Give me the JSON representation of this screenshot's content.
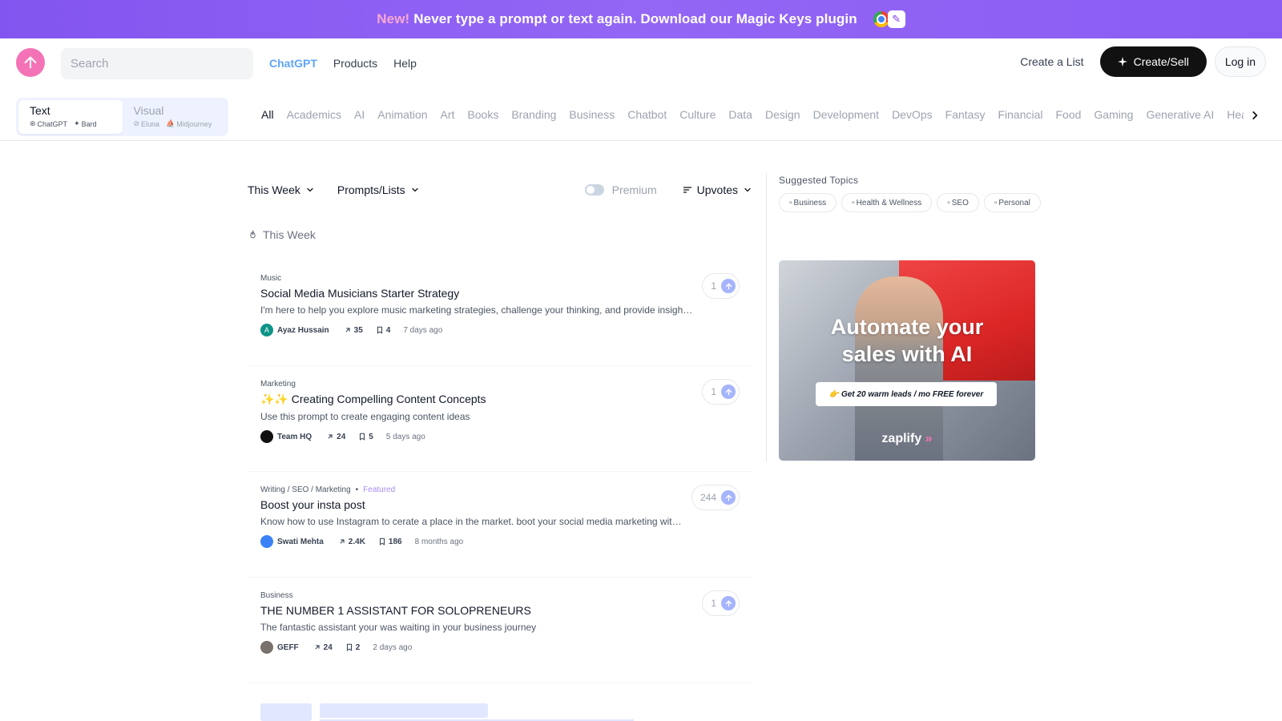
{
  "banner": {
    "new_label": "New!",
    "text": "Never type a prompt or text again. Download our Magic Keys plugin"
  },
  "header": {
    "search_placeholder": "Search",
    "nav": [
      {
        "label": "ChatGPT",
        "active": true
      },
      {
        "label": "Products",
        "active": false
      },
      {
        "label": "Help",
        "active": false
      }
    ],
    "create_list": "Create a List",
    "create_sell": "Create/Sell",
    "login": "Log in"
  },
  "modes": {
    "text": {
      "title": "Text",
      "sub": [
        "ChatGPT",
        "Bard"
      ]
    },
    "visual": {
      "title": "Visual",
      "sub": [
        "Eluna",
        "Midjourney"
      ]
    }
  },
  "categories": [
    "All",
    "Academics",
    "AI",
    "Animation",
    "Art",
    "Books",
    "Branding",
    "Business",
    "Chatbot",
    "Culture",
    "Data",
    "Design",
    "Development",
    "DevOps",
    "Fantasy",
    "Financial",
    "Food",
    "Gaming",
    "Generative AI",
    "Health"
  ],
  "filters": {
    "period": "This Week",
    "type": "Prompts/Lists",
    "premium": "Premium",
    "sort": "Upvotes"
  },
  "section_heading": "This Week",
  "prompts": [
    {
      "category": "Music",
      "featured": "",
      "title": "Social Media Musicians Starter Strategy",
      "description": "I'm here to help you explore music marketing strategies, challenge your thinking, and provide insights for your journey.",
      "author": "Ayaz Hussain",
      "avatar_letter": "A",
      "avatar_color": "#0d9488",
      "uses": "35",
      "saves": "4",
      "time": "7 days ago",
      "upvotes": "1"
    },
    {
      "category": "Marketing",
      "featured": "",
      "title": "✨✨ Creating Compelling Content Concepts",
      "description": "Use this prompt to create engaging content ideas",
      "author": "Team HQ",
      "avatar_letter": "",
      "avatar_color": "#111111",
      "uses": "24",
      "saves": "5",
      "time": "5 days ago",
      "upvotes": "1"
    },
    {
      "category": "Writing / SEO / Marketing",
      "featured": "Featured",
      "title": "Boost your insta post",
      "description": "Know how to use Instagram to cerate a place in the market. boot your social media marketing with these prompts",
      "author": "Swati Mehta",
      "avatar_letter": "",
      "avatar_color": "#3b82f6",
      "uses": "2.4K",
      "saves": "186",
      "time": "8 months ago",
      "upvotes": "244"
    },
    {
      "category": "Business",
      "featured": "",
      "title": "THE NUMBER 1 ASSISTANT FOR SOLOPRENEURS",
      "description": "The fantastic assistant your was waiting in your business journey",
      "author": "GEFF",
      "avatar_letter": "",
      "avatar_color": "#78716c",
      "uses": "24",
      "saves": "2",
      "time": "2 days ago",
      "upvotes": "1"
    }
  ],
  "sidebar": {
    "suggested_title": "Suggested Topics",
    "topics": [
      "Business",
      "Health & Wellness",
      "SEO",
      "Personal"
    ]
  },
  "ad": {
    "headline_1": "Automate your",
    "headline_2": "sales with AI",
    "cta": "👉 Get 20 warm leads / mo FREE forever",
    "brand": "zaplify"
  }
}
